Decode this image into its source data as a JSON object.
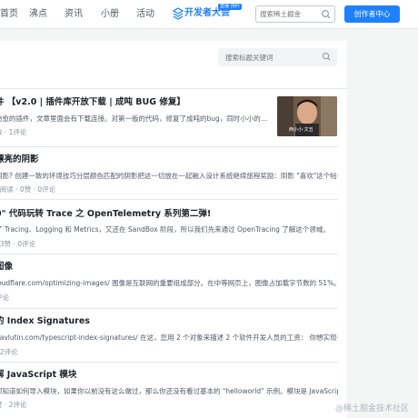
{
  "nav": {
    "items": [
      "首页",
      "沸点",
      "资讯",
      "小册",
      "活动"
    ],
    "brand_text": "开发者大会",
    "brand_badge": "直播·预约",
    "search_placeholder": "搜索稀土掘金",
    "creator_button": "创作者中心"
  },
  "panel": {
    "search_placeholder": "搜索标题关键词"
  },
  "articles": [
    {
      "title": "件 【v2.0 | 插件库开放下载 | 成吨 BUG 修复】",
      "desc": "治愈的插件，文章里面会有下载连接。对第一版的代码，修复了成吨的bug，同时小小的…",
      "meta": "数 · 1评论",
      "thumb_caption": "西小小·文丑"
    },
    {
      "title": "漂亮的阴影",
      "desc": "阴影? 创建一致的环境技巧分层颜色匹配的阴影把这一切放在一起融入设计系统继续旅程奖励：阴影 \"喜欢\"这个帖子…",
      "meta": "5阅读 · 0赞 · 0评论"
    },
    {
      "title": "0\" 代码玩转 Trace 之 OpenTelemetry 系列第二弹!",
      "desc": "了 Tracing、Logging 和 Metrics，又还在 SandBox 阶段，所以我们先来通过 OpenTracing 了解这个领域。",
      "meta": "· 3赞 · 0评论"
    },
    {
      "title": "图像",
      "desc": "loudflare.com/optimizing-images/ 图像是互联网的重要组成部分。在中等网页上，图像占加载字节数的 51%。因…",
      "meta": "评论"
    },
    {
      "title": "的 Index Signatures",
      "desc": "pavlutin.com/typescript-index-signatures/ 在这，您用 2 个对象来描述 2 个软件开发人员的工资： 你想实现一个…",
      "meta": "· 2评论"
    },
    {
      "title": "解 JavaScript 模块",
      "desc": "都知道如何导入模块，如果你以前没有这么做过，那么你还没有看过基本的 \"helloworld\" 示例。模块是 JavaScript …",
      "meta": "赞 · 2评论"
    }
  ],
  "watermark": "@稀土掘金技术社区"
}
